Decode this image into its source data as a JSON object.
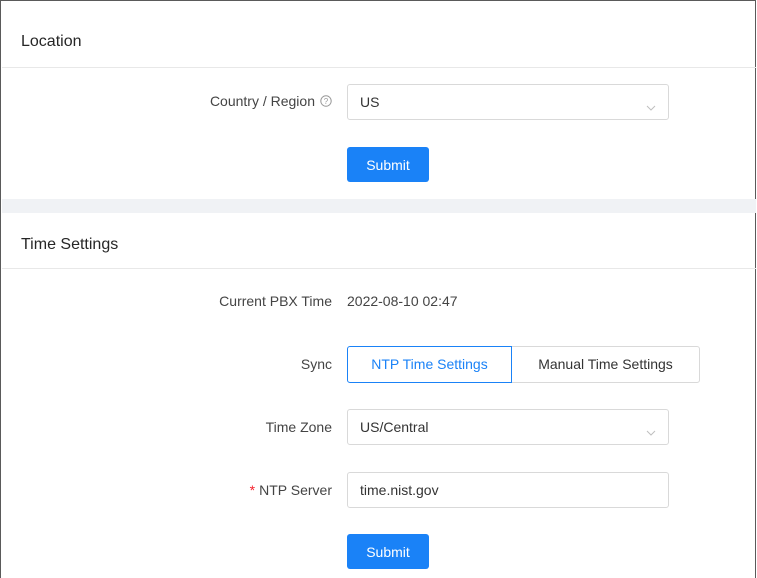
{
  "location": {
    "title": "Location",
    "country_label": "Country / Region",
    "country_value": "US",
    "submit_label": "Submit"
  },
  "time_settings": {
    "title": "Time Settings",
    "current_time_label": "Current PBX Time",
    "current_time_value": "2022-08-10 02:47",
    "sync_label": "Sync",
    "sync_options": [
      "NTP Time Settings",
      "Manual Time Settings"
    ],
    "sync_selected": "NTP Time Settings",
    "timezone_label": "Time Zone",
    "timezone_value": "US/Central",
    "ntp_required_mark": "*",
    "ntp_label": "NTP Server",
    "ntp_value": "time.nist.gov",
    "submit_label": "Submit"
  },
  "colors": {
    "primary": "#1a82f7",
    "required": "#f5222d",
    "border": "#d9d9d9",
    "section_gap": "#f0f2f5"
  }
}
